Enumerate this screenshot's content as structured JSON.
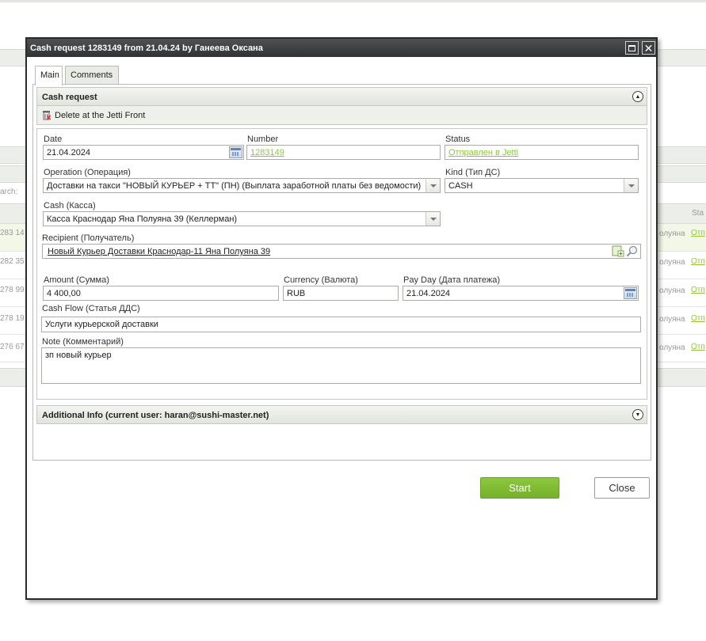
{
  "background": {
    "search_label": "arch:",
    "status_col_label": "Sta",
    "rows": [
      {
        "id_fragment": "283 14",
        "name_fragment": "олуяна",
        "status_fragment": "Отп"
      },
      {
        "id_fragment": "282 35",
        "name_fragment": "олуяна",
        "status_fragment": "Отп"
      },
      {
        "id_fragment": "278 99",
        "name_fragment": "олуяна",
        "status_fragment": "Отп"
      },
      {
        "id_fragment": "278 19",
        "name_fragment": "олуяна",
        "status_fragment": "Отп"
      },
      {
        "id_fragment": "276 67",
        "name_fragment": "олуяна",
        "status_fragment": "Отп"
      }
    ]
  },
  "window": {
    "title": "Cash request 1283149 from 21.04.24 by Ганеева Оксана",
    "maximize_icon": "maximize-icon",
    "close_icon": "close-icon"
  },
  "tabs": [
    {
      "label": "Main",
      "active": true
    },
    {
      "label": "Comments",
      "active": false
    }
  ],
  "cash_request_section": {
    "header": "Cash request",
    "toolbar": {
      "delete_label": "Delete at the Jetti Front"
    }
  },
  "form": {
    "date": {
      "label": "Date",
      "value": "21.04.2024"
    },
    "number": {
      "label": "Number",
      "value": "1283149"
    },
    "status": {
      "label": "Status",
      "value": "Отправлен в Jetti"
    },
    "operation": {
      "label": "Operation (Операция)",
      "value": "Доставки на такси \"НОВЫЙ КУРЬЕР + ТТ\" (ПН) (Выплата заработной платы без ведомости)"
    },
    "kind": {
      "label": "Kind (Тип ДС)",
      "value": "CASH"
    },
    "cash": {
      "label": "Cash (Касса)",
      "value": "Касса Краснодар Яна Полуяна 39 (Келлерман)"
    },
    "recipient": {
      "label": "Recipient (Получатель)",
      "value": "Новый Курьер Доставки Краснодар-11 Яна Полуяна 39"
    },
    "amount": {
      "label": "Amount (Сумма)",
      "value": "4 400,00"
    },
    "currency": {
      "label": "Currency (Валюта)",
      "value": "RUB"
    },
    "pay_day": {
      "label": "Pay Day (Дата платежа)",
      "value": "21.04.2024"
    },
    "cash_flow": {
      "label": "Cash Flow (Статья ДДС)",
      "value": "Услуги курьерской доставки"
    },
    "note": {
      "label": "Note (Комментарий)",
      "value": "зп новый курьер"
    }
  },
  "additional_section": {
    "header": "Additional Info (current user: haran@sushi-master.net)"
  },
  "actions": {
    "start_label": "Start",
    "close_label": "Close"
  },
  "colors": {
    "accent_green": "#8dc63f",
    "titlebar": "#3a3c3d"
  }
}
